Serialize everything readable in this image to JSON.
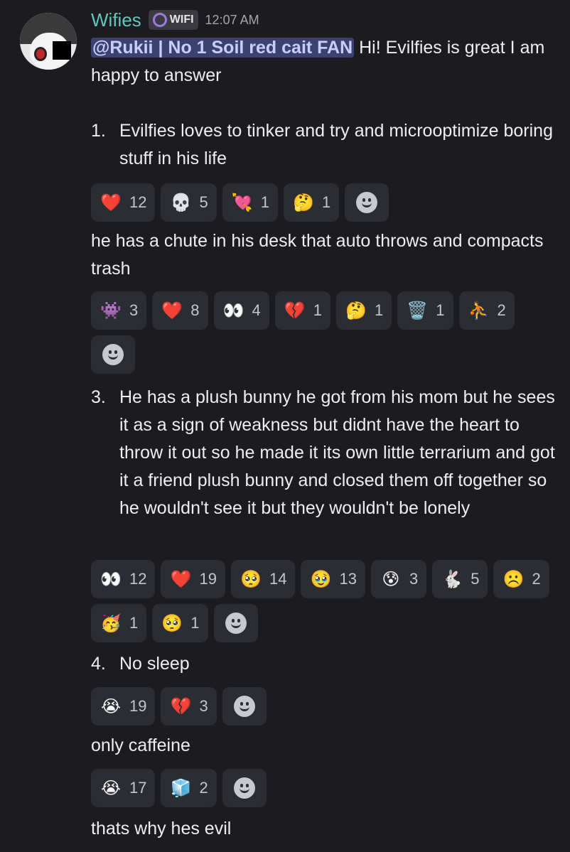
{
  "message": {
    "username": "Wifies",
    "tag": "WIFI",
    "time": "12:07 AM",
    "mention": "@Rukii | No 1 Soil red cait FAN",
    "intro": " Hi! Evilfies is great I am happy to answer"
  },
  "items": [
    {
      "num": "1.",
      "text": "Evilfies loves to tinker and try and microoptimize boring stuff in his life"
    },
    {
      "num": "3.",
      "text": "He has a plush bunny he got from his mom but he sees it as a sign of weakness but didnt have the heart to throw it out so he made it its own little terrarium and got it a friend plush bunny and closed them off together so he wouldn't see it but they wouldn't be lonely"
    },
    {
      "num": "4.",
      "text": "No sleep"
    }
  ],
  "lines": {
    "chute": "he has a chute in his desk that auto throws and compacts trash",
    "caffeine": "only caffeine",
    "evil": "thats why hes evil"
  },
  "reactions": {
    "r1": [
      {
        "emoji": "❤️",
        "icon": "heart-icon",
        "count": "12"
      },
      {
        "emoji": "💀",
        "icon": "skull-icon",
        "count": "5"
      },
      {
        "emoji": "💘",
        "icon": "heart-flower-icon",
        "count": "1"
      },
      {
        "emoji": "🤔",
        "icon": "thinking-face-icon",
        "count": "1"
      }
    ],
    "r2": [
      {
        "emoji": "👾",
        "icon": "ghost-custom-icon",
        "count": "3"
      },
      {
        "emoji": "❤️",
        "icon": "heart-icon",
        "count": "8"
      },
      {
        "emoji": "👀",
        "icon": "eyes-icon",
        "count": "4"
      },
      {
        "emoji": "💔",
        "icon": "broken-heart-icon",
        "count": "1"
      },
      {
        "emoji": "🤔",
        "icon": "thinking-face-icon",
        "count": "1"
      },
      {
        "emoji": "🗑️",
        "icon": "trash-can-icon",
        "count": "1"
      },
      {
        "emoji": "⛹️",
        "icon": "basketball-player-icon",
        "count": "2"
      }
    ],
    "r3": [
      {
        "emoji": "👀",
        "icon": "eyes-icon",
        "count": "12"
      },
      {
        "emoji": "❤️",
        "icon": "heart-icon",
        "count": "19"
      },
      {
        "emoji": "🥺",
        "icon": "pleading-face-icon",
        "count": "14"
      },
      {
        "emoji": "🥹",
        "icon": "holding-tears-face-icon",
        "count": "13"
      },
      {
        "emoji": "😰",
        "icon": "custom-crying-blue-icon",
        "count": "3"
      },
      {
        "emoji": "🐇",
        "icon": "rabbit-icon",
        "count": "5"
      },
      {
        "emoji": "☹️",
        "icon": "frowning-face-icon",
        "count": "2"
      },
      {
        "emoji": "🥳",
        "icon": "custom-party-icon",
        "count": "1"
      },
      {
        "emoji": "🥺",
        "icon": "custom-pleading-blue-icon",
        "count": "1"
      }
    ],
    "r4": [
      {
        "emoji": "😭",
        "icon": "loudly-crying-face-icon",
        "count": "19"
      },
      {
        "emoji": "💔",
        "icon": "broken-heart-icon",
        "count": "3"
      }
    ],
    "r5": [
      {
        "emoji": "😭",
        "icon": "loudly-crying-face-icon",
        "count": "17"
      },
      {
        "emoji": "🧊",
        "icon": "custom-sticker-icon",
        "count": "2"
      }
    ]
  }
}
